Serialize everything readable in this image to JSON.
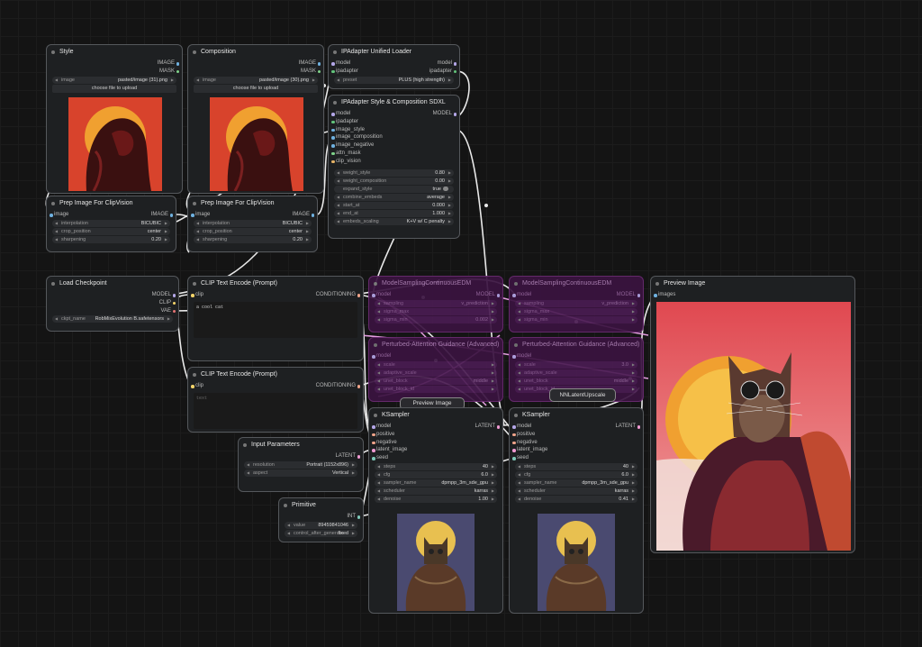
{
  "nodes": {
    "style": {
      "title": "Style",
      "out1": "IMAGE",
      "out2": "MASK",
      "image_label": "image",
      "image_value": "pasted/image (31).png",
      "upload": "choose file to upload"
    },
    "composition": {
      "title": "Composition",
      "out1": "IMAGE",
      "out2": "MASK",
      "image_label": "image",
      "image_value": "pasted/image (30).png",
      "upload": "choose file to upload"
    },
    "ipa_loader": {
      "title": "IPAdapter Unified Loader",
      "in1": "model",
      "in2": "ipadapter",
      "out1": "model",
      "out2": "ipadapter",
      "preset_label": "preset",
      "preset_value": "PLUS (high strength)"
    },
    "ipa_style": {
      "title": "IPAdapter Style & Composition SDXL",
      "out1": "MODEL",
      "inputs": [
        "model",
        "ipadapter",
        "image_style",
        "image_composition",
        "image_negative",
        "attn_mask",
        "clip_vision"
      ],
      "widgets": [
        {
          "label": "weight_style",
          "value": "0.80"
        },
        {
          "label": "weight_composition",
          "value": "0.00"
        },
        {
          "label": "expand_style",
          "value": "true"
        },
        {
          "label": "combine_embeds",
          "value": "average"
        },
        {
          "label": "start_at",
          "value": "0.000"
        },
        {
          "label": "end_at",
          "value": "1.000"
        },
        {
          "label": "embeds_scaling",
          "value": "K+V w/ C penalty"
        }
      ]
    },
    "prep1": {
      "title": "Prep Image For ClipVision",
      "in1": "image",
      "out1": "IMAGE",
      "widgets": [
        {
          "label": "interpolation",
          "value": "BICUBIC"
        },
        {
          "label": "crop_position",
          "value": "center"
        },
        {
          "label": "sharpening",
          "value": "0.20"
        }
      ]
    },
    "prep2": {
      "title": "Prep Image For ClipVision",
      "in1": "image",
      "out1": "IMAGE",
      "widgets": [
        {
          "label": "interpolation",
          "value": "BICUBIC"
        },
        {
          "label": "crop_position",
          "value": "center"
        },
        {
          "label": "sharpening",
          "value": "0.20"
        }
      ]
    },
    "checkpoint": {
      "title": "Load Checkpoint",
      "out1": "MODEL",
      "out2": "CLIP",
      "out3": "VAE",
      "ckpt_label": "ckpt_name",
      "ckpt_value": "RobMixEvolution B.safetensors"
    },
    "clip1": {
      "title": "CLIP Text Encode (Prompt)",
      "in1": "clip",
      "out1": "CONDITIONING",
      "text": "a cool cat"
    },
    "clip2": {
      "title": "CLIP Text Encode (Prompt)",
      "in1": "clip",
      "out1": "CONDITIONING",
      "placeholder": "text"
    },
    "msedm1": {
      "title": "ModelSamplingContinuousEDM",
      "in1": "model",
      "out1": "MODEL",
      "w1": "sampling",
      "w1v": "v_prediction",
      "w2": "sigma_max",
      "w3": "sigma_min",
      "w3v": "0.002"
    },
    "msedm2": {
      "title": "ModelSamplingContinuousEDM",
      "in1": "model",
      "out1": "MODEL",
      "w1": "sampling",
      "w1v": "v_prediction",
      "w2": "sigma_max",
      "w3": "sigma_min"
    },
    "pag1": {
      "title": "Perturbed-Attention Guidance (Advanced)",
      "in1": "model",
      "w1": "scale",
      "w2": "adaptive_scale",
      "w3": "unet_block",
      "w3v": "middle",
      "w4": "unet_block_id"
    },
    "pag2": {
      "title": "Perturbed-Attention Guidance (Advanced)",
      "in1": "model",
      "w1": "scale",
      "w1v": "3.0",
      "w2": "adaptive_scale",
      "w3": "unet_block",
      "w3v": "middle",
      "w4": "unet_block_id"
    },
    "preview_small": {
      "title": "Preview Image"
    },
    "nnlatent": {
      "title": "NNLatentUpscale"
    },
    "input_params": {
      "title": "Input Parameters",
      "out1": "LATENT",
      "widgets": [
        {
          "label": "resolution",
          "value": "Portrait (1152x896)"
        },
        {
          "label": "aspect",
          "value": "Vertical"
        }
      ]
    },
    "primitive": {
      "title": "Primitive",
      "out1": "INT",
      "widgets": [
        {
          "label": "value",
          "value": "89459841046"
        },
        {
          "label": "control_after_generate",
          "value": "fixed"
        }
      ]
    },
    "ksampler1": {
      "title": "KSampler",
      "out1": "LATENT",
      "inputs": [
        "model",
        "positive",
        "negative",
        "latent_image",
        "seed"
      ],
      "widgets": [
        {
          "label": "steps",
          "value": "40"
        },
        {
          "label": "cfg",
          "value": "6.0"
        },
        {
          "label": "sampler_name",
          "value": "dpmpp_3m_sde_gpu"
        },
        {
          "label": "scheduler",
          "value": "karras"
        },
        {
          "label": "denoise",
          "value": "1.00"
        }
      ]
    },
    "ksampler2": {
      "title": "KSampler",
      "out1": "LATENT",
      "inputs": [
        "model",
        "positive",
        "negative",
        "latent_image",
        "seed"
      ],
      "widgets": [
        {
          "label": "steps",
          "value": "40"
        },
        {
          "label": "cfg",
          "value": "6.0"
        },
        {
          "label": "sampler_name",
          "value": "dpmpp_3m_sde_gpu"
        },
        {
          "label": "scheduler",
          "value": "karras"
        },
        {
          "label": "denoise",
          "value": "0.41"
        }
      ]
    },
    "preview": {
      "title": "Preview Image",
      "in1": "images"
    }
  },
  "colors": {
    "background": "#141414",
    "node": "#1e2022",
    "bypassed": "#3a1340",
    "wire": "#e8e8e8",
    "wire_latent": "#e49fe0"
  }
}
